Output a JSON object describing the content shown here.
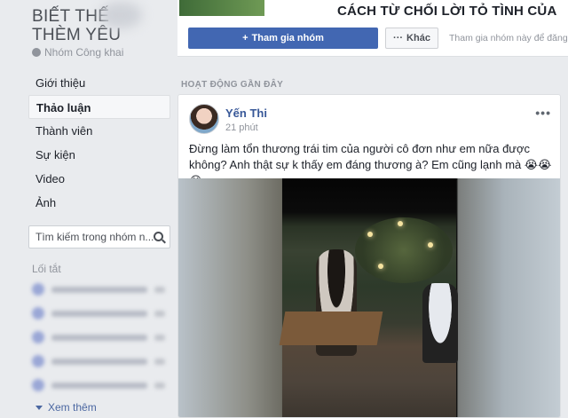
{
  "group": {
    "name": "BIẾT THẾ THÈM YÊU",
    "privacy": "Nhóm Công khai"
  },
  "nav": {
    "items": [
      {
        "label": "Giới thiệu",
        "active": false
      },
      {
        "label": "Thảo luận",
        "active": true
      },
      {
        "label": "Thành viên",
        "active": false
      },
      {
        "label": "Sự kiện",
        "active": false
      },
      {
        "label": "Video",
        "active": false
      },
      {
        "label": "Ảnh",
        "active": false
      }
    ]
  },
  "search": {
    "placeholder": "Tìm kiếm trong nhóm n..."
  },
  "shortcuts": {
    "title": "Lối tắt",
    "see_more": "Xem thêm"
  },
  "header": {
    "cover_title": "CÁCH TỪ CHỐI LỜI TỎ TÌNH CỦA",
    "join_label": "Tham gia nhóm",
    "more_label": "Khác",
    "join_hint": "Tham gia nhóm này để đăng"
  },
  "section": {
    "label": "HOẠT ĐỘNG GẦN ĐÂY"
  },
  "post": {
    "author": "Yến Thi",
    "time": "21 phút",
    "text": "Đừng làm tổn thương trái tim của người cô đơn như em nữa được không? Anh thật sự k thấy em đáng thương à? Em cũng lạnh mà 😭😭😭"
  },
  "colors": {
    "accent": "#4267b2",
    "link": "#385898",
    "background": "#e9ebee"
  },
  "icons": [
    "globe-icon",
    "search-icon",
    "plus-icon",
    "more-dots-icon",
    "chevron-down-icon"
  ]
}
